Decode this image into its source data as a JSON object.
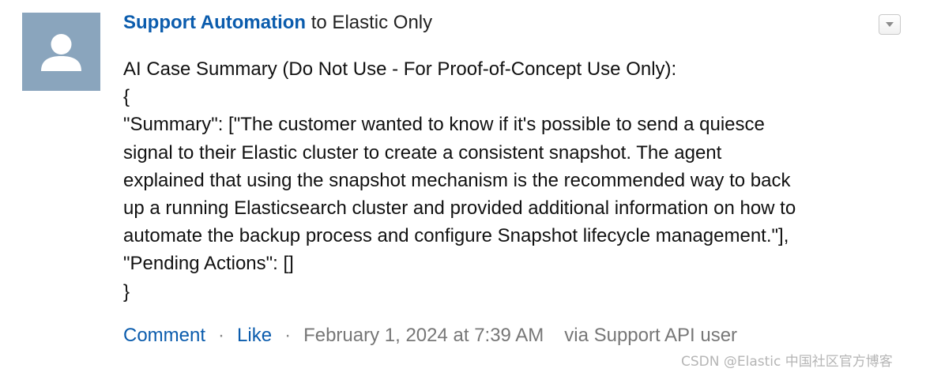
{
  "post": {
    "author": "Support Automation",
    "to_text": " to Elastic Only",
    "avatar": {
      "icon": "user-silhouette-icon",
      "background": "#8aa5bd"
    },
    "menu": {
      "icon": "chevron-down-icon"
    },
    "body_lines": [
      "AI Case Summary (Do Not Use - For Proof-of-Concept Use Only):",
      "{",
      "\"Summary\": [\"The customer wanted to know if it's possible to send a quiesce",
      "signal to their Elastic cluster to create a consistent snapshot. The agent",
      "explained that using the snapshot mechanism is the recommended way to back",
      "up a running Elasticsearch cluster and provided additional information on how to",
      "automate the backup process and configure Snapshot lifecycle management.\"],",
      "\"Pending Actions\": []",
      "}"
    ],
    "footer": {
      "comment_label": "Comment",
      "separator": "·",
      "like_label": "Like",
      "timestamp": "February 1, 2024 at 7:39 AM",
      "via": "via Support API user"
    }
  },
  "watermark": "CSDN @Elastic 中国社区官方博客",
  "colors": {
    "link": "#0b5cad",
    "muted": "#777777",
    "text": "#111111"
  }
}
